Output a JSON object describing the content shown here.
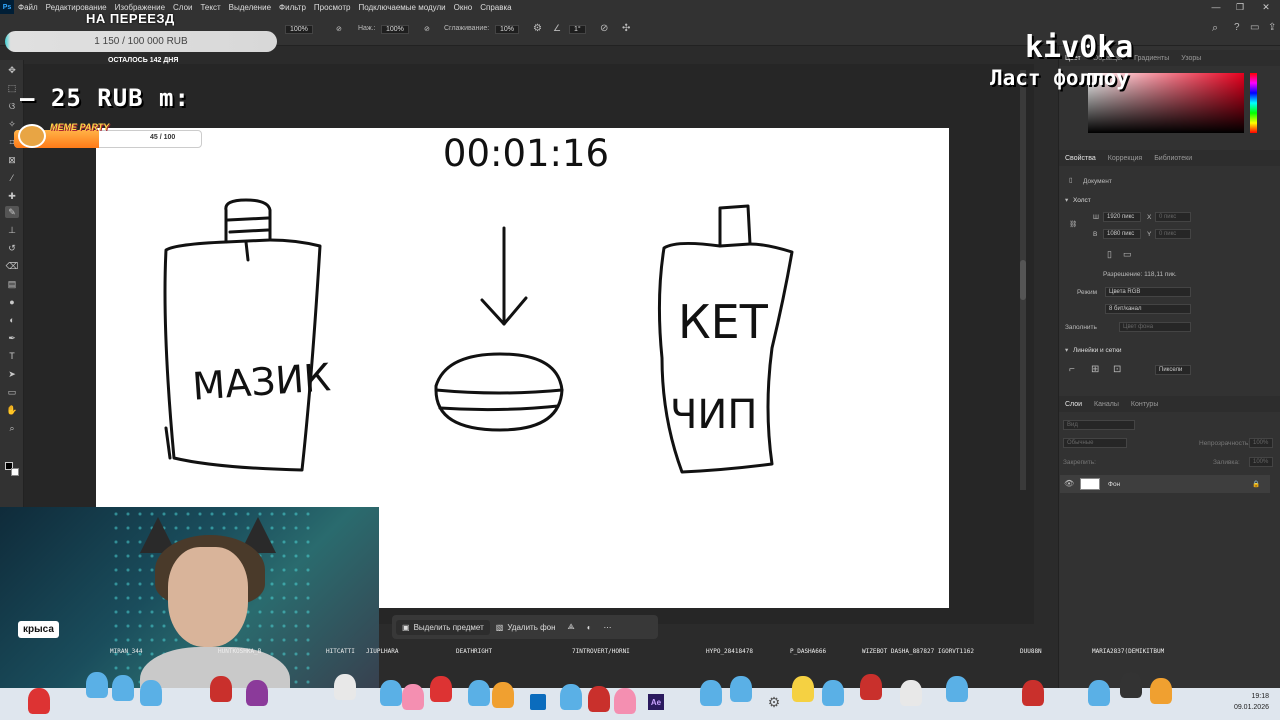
{
  "menubar": {
    "logo": "Ps",
    "items": [
      "Файл",
      "Редактирование",
      "Изображение",
      "Слои",
      "Текст",
      "Выделение",
      "Фильтр",
      "Просмотр",
      "Подключаемые модули",
      "Окно",
      "Справка"
    ]
  },
  "options": {
    "opacity_value": "100%",
    "press_label": "Наж.:",
    "press_value": "100%",
    "smoothing_label": "Сглаживание:",
    "smoothing_value": "10%",
    "angle_value": "1°"
  },
  "canvas": {
    "timer": "00:01:16",
    "drawing_texts": [
      "МАЗИК",
      "КЕТ",
      "ЧИП"
    ]
  },
  "context_bar": {
    "select_subject": "Выделить предмет",
    "remove_bg": "Удалить фон"
  },
  "right_panel": {
    "top_tabs": [
      "Цвет",
      "Образцы",
      "Градиенты",
      "Узоры"
    ],
    "props_tabs": [
      "Свойства",
      "Коррекция",
      "Библиотеки"
    ],
    "doc_label": "Документ",
    "canvas_section": "Холст",
    "w_label": "Ш",
    "w_value": "1920 пикс",
    "h_label": "В",
    "h_value": "1080 пикс",
    "x_label": "X",
    "y_label": "Y",
    "x_value": "0 пикс",
    "y_value": "0 пикс",
    "resolution": "Разрешение: 118,11 пик.",
    "mode_label": "Режим",
    "mode_value": "Цвета RGB",
    "bits_value": "8 бит/канал",
    "fill_label": "Заполнить",
    "fill_value": "Цвет фона",
    "rulers_section": "Линейки и сетки",
    "units_value": "Пиксели",
    "layers_tabs": [
      "Слои",
      "Каналы",
      "Контуры"
    ],
    "search_placeholder": "Вид",
    "blend_mode": "Обычные",
    "opacity_label": "Непрозрачность:",
    "opacity_value": "100%",
    "lock_label": "Закрепить:",
    "fill_layer_label": "Заливка:",
    "fill_layer_value": "100%",
    "layer_name": "Фон"
  },
  "overlay": {
    "donation_title": "НА ПЕРЕЕЗД",
    "donation_progress": "1 150 / 100 000 RUB",
    "donation_progress_fraction": 0.0115,
    "donation_days": "ОСТАЛОСЬ 142 ДНЯ",
    "last_donation": "– 25 RUB    m:",
    "meme_label": "MEME PARTY",
    "meme_count": "45 / 100",
    "meme_fraction": 0.45,
    "streamer_name": "kiv0ka",
    "last_follow": "Ласт фоллоу",
    "rat_label": "крыса",
    "chat_names": [
      "MIRAN_344",
      "HUNTKOSHKA_B",
      "HITCATTI",
      "JIUPLHARA",
      "DEATHRIGHT",
      "7INTROVERT/HORNI",
      "HYPO_28418478",
      "P_DASHA666",
      "WIZEBOT DASHA_887827 IGORVT1162",
      "DUU88N",
      "MARIA2837(DEMIKITBUM"
    ]
  },
  "taskbar": {
    "time": "19:18",
    "date": "09.01.2026"
  },
  "colors": {
    "ps_dark": "#323232",
    "ps_bg": "#262626",
    "canvas": "#ffffff",
    "accent_red": "#e8001e"
  }
}
